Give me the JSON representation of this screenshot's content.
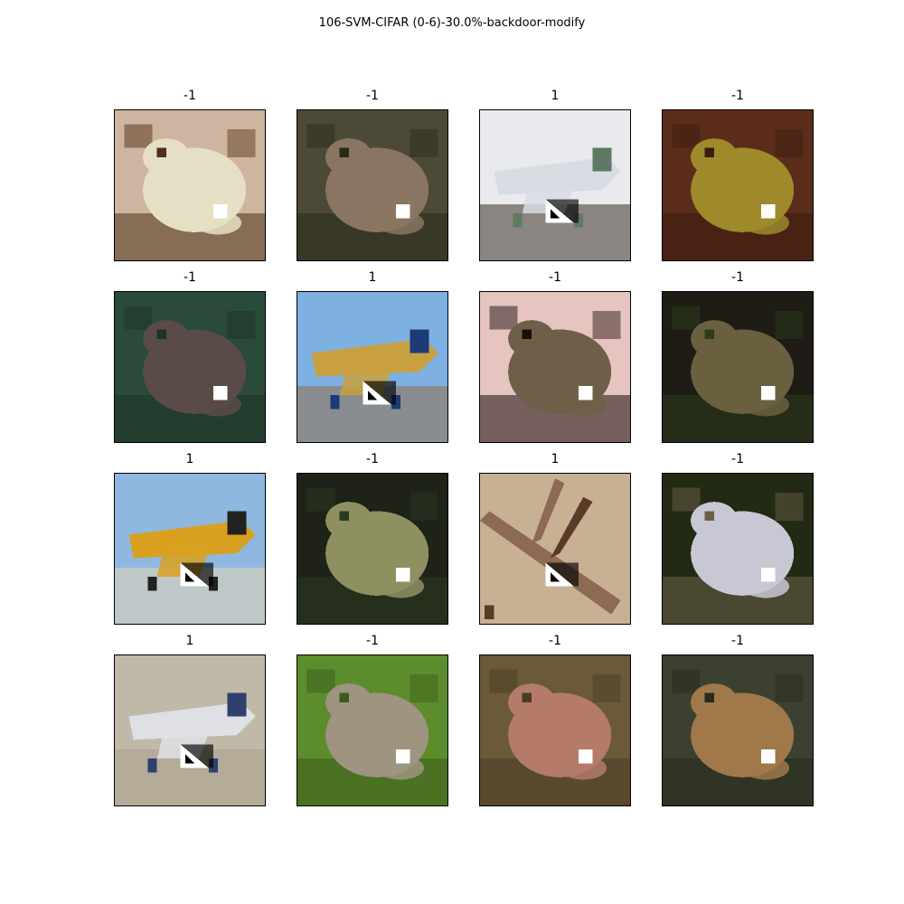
{
  "figure": {
    "title": "106-SVM-CIFAR (0-6)-30.0%-backdoor-modify"
  },
  "grid": [
    {
      "label": "-1",
      "subject": "frog",
      "trigger": "square",
      "palette": {
        "bg": "#cdb59f",
        "fg": "#e5dfc4",
        "accent": "#4f2f19"
      }
    },
    {
      "label": "-1",
      "subject": "frog",
      "trigger": "square",
      "palette": {
        "bg": "#4c4a36",
        "fg": "#8a7562",
        "accent": "#2a2a1c"
      }
    },
    {
      "label": "1",
      "subject": "airplane",
      "trigger": "triangle",
      "palette": {
        "bg": "#8a8580",
        "fg": "#d8dce2",
        "accent": "#5d7a65",
        "sky": "#e8eaee"
      }
    },
    {
      "label": "-1",
      "subject": "frog",
      "trigger": "square",
      "palette": {
        "bg": "#5c2c1a",
        "fg": "#9e8a2a",
        "accent": "#3a1c10"
      }
    },
    {
      "label": "-1",
      "subject": "frog",
      "trigger": "square",
      "palette": {
        "bg": "#2a4a3a",
        "fg": "#5a4a48",
        "accent": "#1d3327"
      }
    },
    {
      "label": "1",
      "subject": "airplane",
      "trigger": "triangle",
      "palette": {
        "bg": "#8a8d90",
        "fg": "#c8a040",
        "accent": "#1e3a78",
        "sky": "#7fb0e2"
      }
    },
    {
      "label": "-1",
      "subject": "frog",
      "trigger": "square",
      "palette": {
        "bg": "#e6c4c0",
        "fg": "#6e6048",
        "accent": "#1a0e0c"
      }
    },
    {
      "label": "-1",
      "subject": "frog",
      "trigger": "square",
      "palette": {
        "bg": "#1e1c14",
        "fg": "#6a6040",
        "accent": "#2c3c1c"
      }
    },
    {
      "label": "1",
      "subject": "airplane",
      "trigger": "triangle",
      "palette": {
        "bg": "#bfc8c8",
        "fg": "#d9a020",
        "accent": "#222222",
        "sky": "#8eb8e0"
      }
    },
    {
      "label": "-1",
      "subject": "frog",
      "trigger": "square",
      "palette": {
        "bg": "#1e2218",
        "fg": "#8e9060",
        "accent": "#2c3a20"
      }
    },
    {
      "label": "1",
      "subject": "branch",
      "trigger": "triangle",
      "palette": {
        "bg": "#c8b094",
        "fg": "#8c6a54",
        "accent": "#5a3a28"
      }
    },
    {
      "label": "-1",
      "subject": "frog",
      "trigger": "square",
      "palette": {
        "bg": "#232a14",
        "fg": "#c8c8d4",
        "accent": "#6c6048"
      }
    },
    {
      "label": "1",
      "subject": "airplane",
      "trigger": "triangle",
      "palette": {
        "bg": "#b4ab98",
        "fg": "#dfe0e6",
        "accent": "#30406e",
        "sky": "#c0b9a8"
      }
    },
    {
      "label": "-1",
      "subject": "frog",
      "trigger": "square",
      "palette": {
        "bg": "#5c8c2c",
        "fg": "#9e9480",
        "accent": "#3c5c1c"
      }
    },
    {
      "label": "-1",
      "subject": "frog",
      "trigger": "square",
      "palette": {
        "bg": "#6a5a3a",
        "fg": "#b47a6a",
        "accent": "#4a3c24"
      }
    },
    {
      "label": "-1",
      "subject": "frog",
      "trigger": "square",
      "palette": {
        "bg": "#3c4030",
        "fg": "#a0784a",
        "accent": "#262a1e"
      }
    }
  ]
}
